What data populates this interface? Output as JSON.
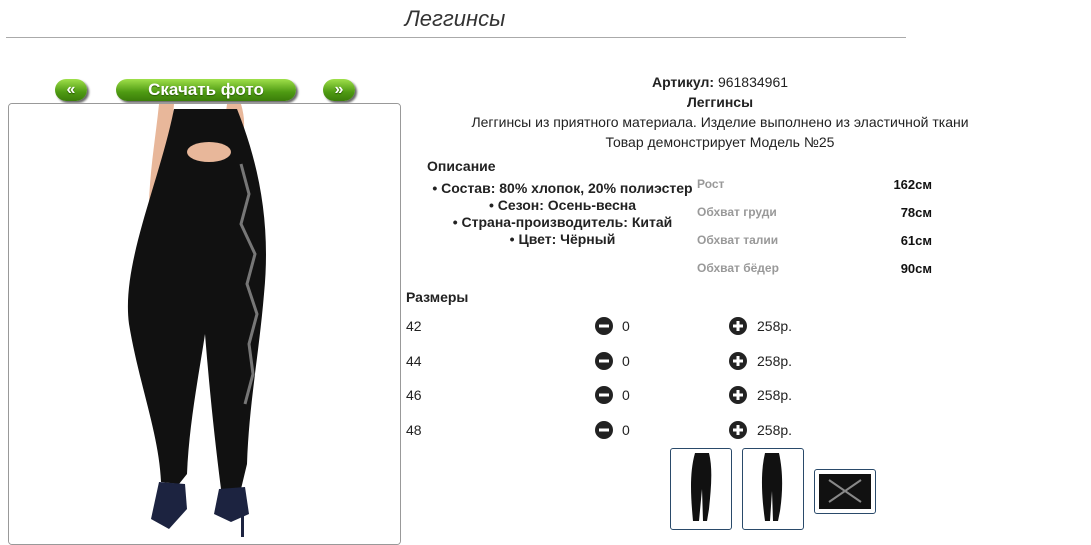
{
  "page": {
    "title": "Леггинсы"
  },
  "gallery": {
    "prev_label": "«",
    "download_label": "Скачать фото",
    "next_label": "»"
  },
  "product": {
    "article_label": "Артикул:",
    "article_value": "961834961",
    "name": "Леггинсы",
    "description": "Леггинсы из приятного материала. Изделие выполнено из эластичной ткани",
    "model_note": "Товар демонстрирует Модель №25"
  },
  "details": {
    "title": "Описание",
    "items": [
      "• Состав: 80% хлопок, 20% полиэстер",
      "• Сезон: Осень-весна",
      "• Страна-производитель: Китай",
      "• Цвет: Чёрный"
    ]
  },
  "measurements": [
    {
      "label": "Рост",
      "value": "162см"
    },
    {
      "label": "Обхват груди",
      "value": "78см"
    },
    {
      "label": "Обхват талии",
      "value": "61см"
    },
    {
      "label": "Обхват бёдер",
      "value": "90см"
    }
  ],
  "sizes": {
    "title": "Размеры",
    "rows": [
      {
        "size": "42",
        "qty": "0",
        "price": "258р."
      },
      {
        "size": "44",
        "qty": "0",
        "price": "258р."
      },
      {
        "size": "46",
        "qty": "0",
        "price": "258р."
      },
      {
        "size": "48",
        "qty": "0",
        "price": "258р."
      }
    ]
  },
  "colors": {
    "accent_green": "#4e9a12",
    "thumb_border": "#2a4a6a",
    "legging": "#111111"
  }
}
